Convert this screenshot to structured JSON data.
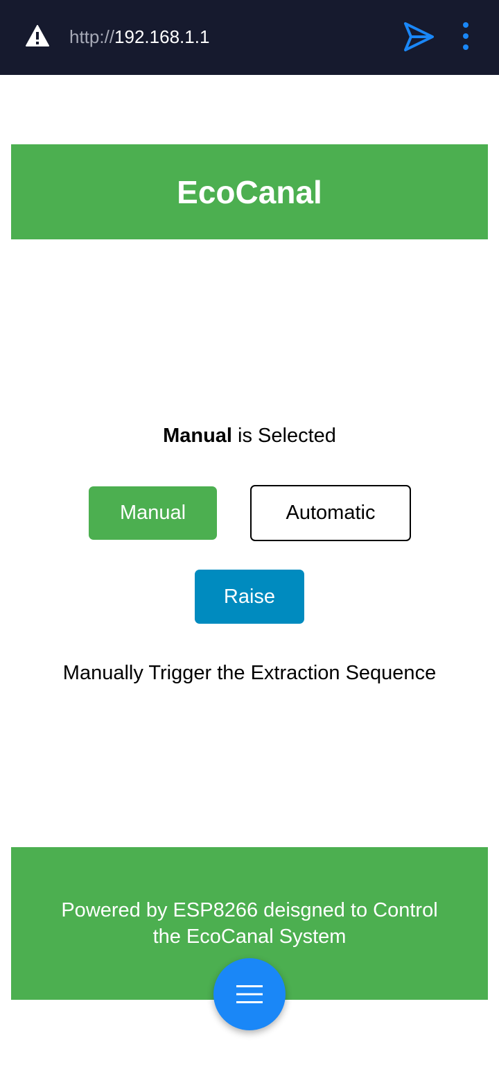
{
  "browser": {
    "url_scheme": "http://",
    "url_host": "192.168.1.1",
    "icons": {
      "warning": "warning-icon",
      "send": "send-icon",
      "more": "more-vert-icon"
    },
    "accent_color": "#1a87f7"
  },
  "header": {
    "title": "EcoCanal"
  },
  "status": {
    "mode": "Manual",
    "suffix": " is Selected"
  },
  "buttons": {
    "manual_label": "Manual",
    "automatic_label": "Automatic",
    "raise_label": "Raise"
  },
  "description": "Manually Trigger the Extraction Sequence",
  "footer": {
    "line1": "Powered by ESP8266 deisgned to Control",
    "line2": "the EcoCanal System"
  },
  "fab": {
    "icon": "menu-icon"
  },
  "colors": {
    "brand_green": "#4caf50",
    "raise_blue": "#008bbf",
    "browser_bg": "#161a2e"
  }
}
